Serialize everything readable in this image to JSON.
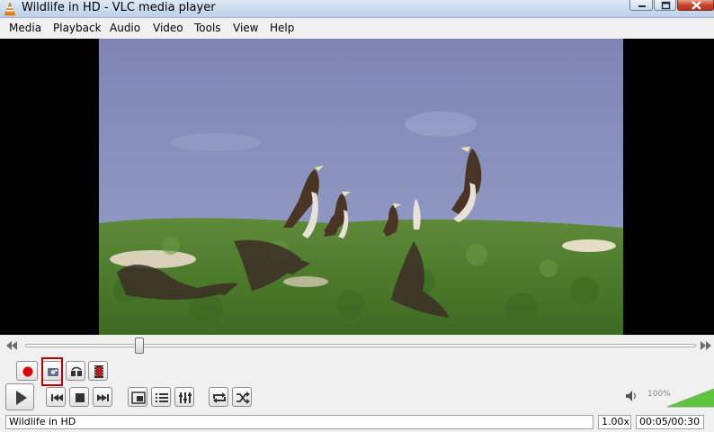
{
  "window": {
    "title": "Wildlife in HD - VLC media player"
  },
  "menubar": {
    "items": [
      "Media",
      "Playback",
      "Audio",
      "Video",
      "Tools",
      "View",
      "Help"
    ]
  },
  "seek": {
    "progress": 0.17
  },
  "controls": {
    "advanced": [
      "record-button",
      "snapshot-button",
      "loop-ab-button",
      "frame-by-frame-button"
    ],
    "highlighted": "snapshot-button"
  },
  "volume": {
    "label": "100%",
    "level": 1.0
  },
  "status": {
    "media_name": "Wildlife in HD",
    "speed": "1.00x",
    "time": "00:05/00:30"
  }
}
